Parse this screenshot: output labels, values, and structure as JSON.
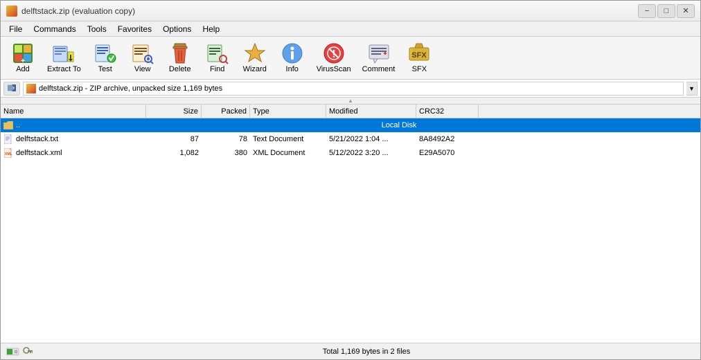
{
  "titlebar": {
    "title": "delftstack.zip (evaluation copy)",
    "icon": "zip-icon",
    "buttons": {
      "minimize": "−",
      "maximize": "□",
      "close": "✕"
    }
  },
  "menubar": {
    "items": [
      "File",
      "Commands",
      "Tools",
      "Favorites",
      "Options",
      "Help"
    ]
  },
  "toolbar": {
    "buttons": [
      {
        "id": "add",
        "label": "Add",
        "icon": "add-icon"
      },
      {
        "id": "extract",
        "label": "Extract To",
        "icon": "extract-icon"
      },
      {
        "id": "test",
        "label": "Test",
        "icon": "test-icon"
      },
      {
        "id": "view",
        "label": "View",
        "icon": "view-icon"
      },
      {
        "id": "delete",
        "label": "Delete",
        "icon": "delete-icon"
      },
      {
        "id": "find",
        "label": "Find",
        "icon": "find-icon"
      },
      {
        "id": "wizard",
        "label": "Wizard",
        "icon": "wizard-icon"
      },
      {
        "id": "info",
        "label": "Info",
        "icon": "info-icon"
      },
      {
        "id": "virusscan",
        "label": "VirusScan",
        "icon": "virusscan-icon"
      },
      {
        "id": "comment",
        "label": "Comment",
        "icon": "comment-icon"
      },
      {
        "id": "sfx",
        "label": "SFX",
        "icon": "sfx-icon"
      }
    ]
  },
  "addressbar": {
    "path": " delftstack.zip - ZIP archive, unpacked size 1,169 bytes",
    "chevron": "▼"
  },
  "columns": {
    "name": "Name",
    "size": "Size",
    "packed": "Packed",
    "type": "Type",
    "modified": "Modified",
    "crc": "CRC32"
  },
  "files": [
    {
      "id": "parent",
      "name": "..",
      "size": "",
      "packed": "",
      "type": "Local Disk",
      "modified": "",
      "crc": "",
      "selected": true,
      "icon": "folder"
    },
    {
      "id": "txt",
      "name": "delftstack.txt",
      "size": "87",
      "packed": "78",
      "type": "Text Document",
      "modified": "5/21/2022 1:04 ...",
      "crc": "8A8492A2",
      "selected": false,
      "icon": "txt"
    },
    {
      "id": "xml",
      "name": "delftstack.xml",
      "size": "1,082",
      "packed": "380",
      "type": "XML Document",
      "modified": "5/12/2022 3:20 ...",
      "crc": "E29A5070",
      "selected": false,
      "icon": "xml"
    }
  ],
  "statusbar": {
    "text": "Total 1,169 bytes in 2 files"
  }
}
